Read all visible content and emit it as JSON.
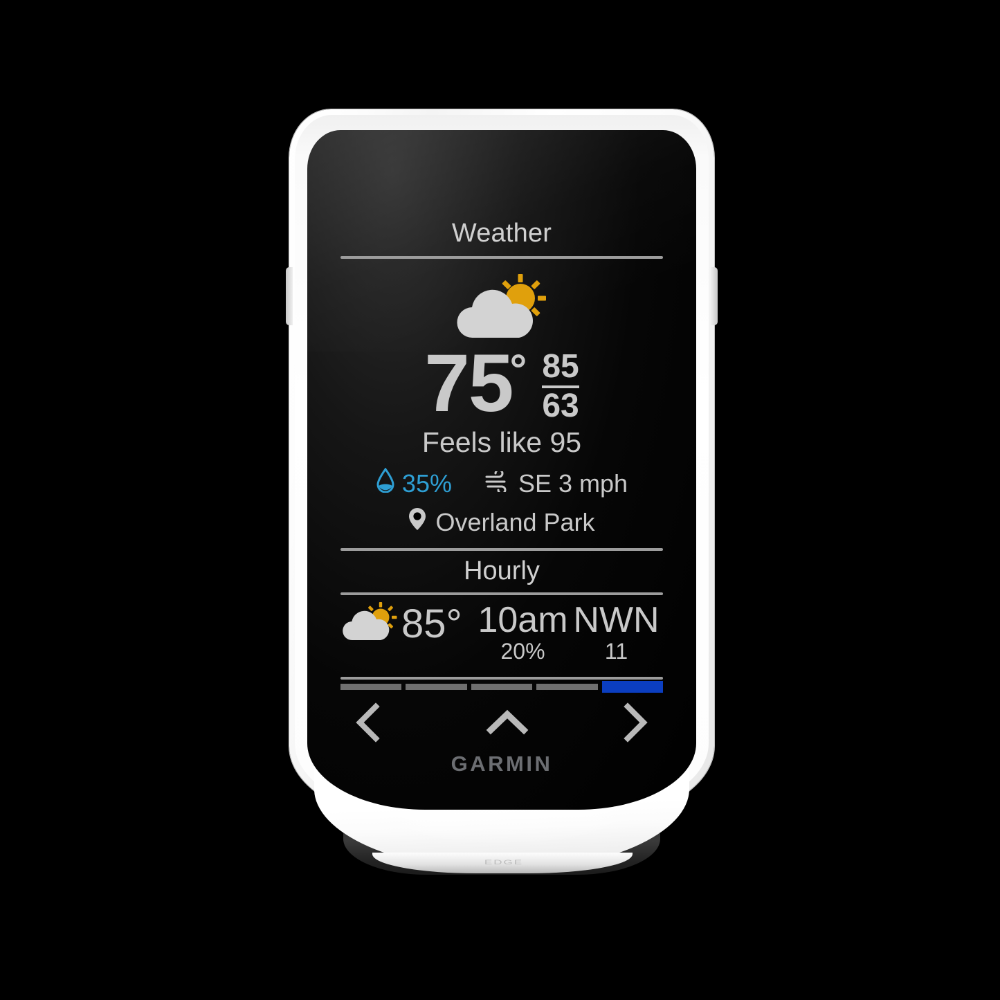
{
  "device": {
    "brand": "GARMIN",
    "model_text": "EDGE",
    "accent_blue": "#0b3ec0",
    "humidity_blue": "#2e9fd4",
    "sun_amber": "#e09b10",
    "text_gray": "#c9c9c9"
  },
  "screen": {
    "title": "Weather",
    "condition_icon": "partly-cloudy-day-icon",
    "temperature": "75",
    "degree_symbol": "°",
    "high": "85",
    "low": "63",
    "feels_like": "Feels like 95",
    "humidity": {
      "icon": "water-drop-icon",
      "value": "35%"
    },
    "wind": {
      "icon": "wind-icon",
      "value": "SE 3 mph"
    },
    "location": {
      "icon": "map-pin-icon",
      "name": "Overland Park"
    },
    "hourly": {
      "section_title": "Hourly",
      "rows": [
        {
          "icon": "partly-cloudy-day-icon",
          "temp": "85°",
          "time": "10am",
          "precip": "20%",
          "wind_dir": "NWN",
          "wind_speed": "11"
        }
      ]
    },
    "pager": {
      "total": 5,
      "active_index": 4
    },
    "nav": {
      "back_label": "‹",
      "up_label": "⌃",
      "forward_label": "›"
    }
  }
}
